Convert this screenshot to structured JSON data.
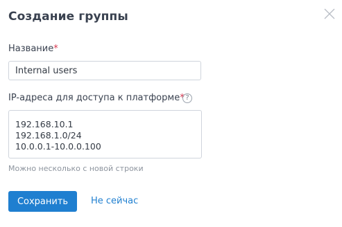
{
  "dialog": {
    "title": "Создание группы",
    "close_icon": "close-icon"
  },
  "form": {
    "name_label": "Название",
    "name_required_mark": "*",
    "name_value": "Internal users",
    "ip_label": "IP-адреса для доступа к платформе",
    "ip_required_mark": "*",
    "ip_help_icon": "question-mark-icon",
    "ip_help_glyph": "?",
    "ip_value": "192.168.10.1\n192.168.1.0/24\n10.0.0.1-10.0.0.100",
    "ip_hint": "Можно несколько с новой строки"
  },
  "actions": {
    "save_label": "Сохранить",
    "cancel_label": "Не сейчас"
  },
  "colors": {
    "accent": "#1f7fd0",
    "required": "#d7374f",
    "text": "#3a4250",
    "hint": "#8d949e",
    "border": "#cfd4dc"
  }
}
